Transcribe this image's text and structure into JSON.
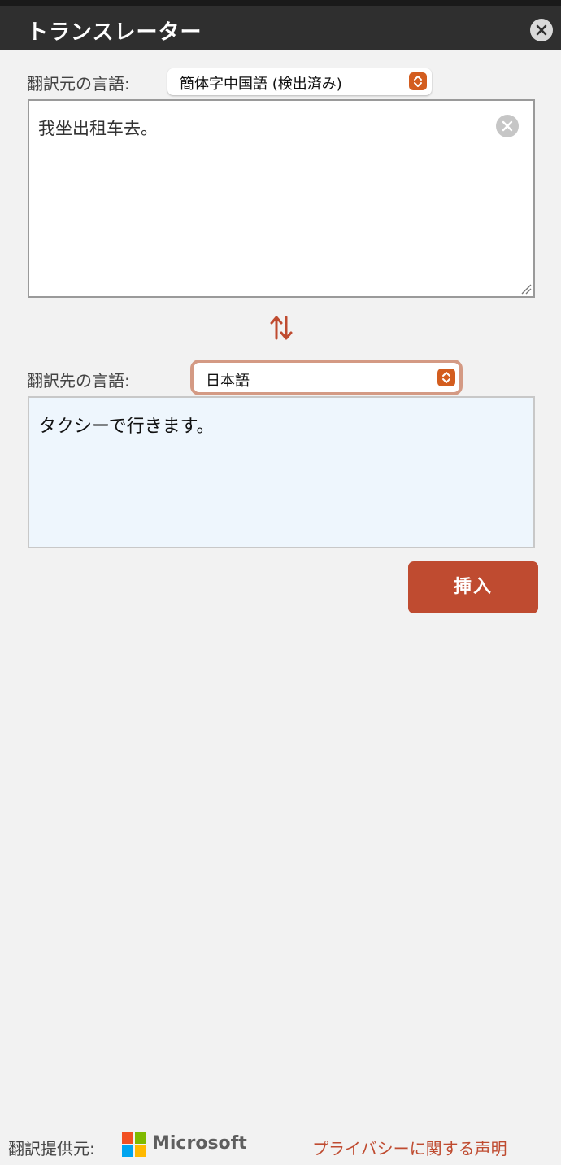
{
  "header": {
    "title": "トランスレーター",
    "close_icon": "close-icon"
  },
  "source": {
    "label": "翻訳元の言語:",
    "selected_language": "簡体字中国語 (検出済み)",
    "text": "我坐出租车去。",
    "clear_icon": "clear-icon"
  },
  "swap_icon": "swap-arrows-icon",
  "target": {
    "label": "翻訳先の言語:",
    "selected_language": "日本語",
    "text": "タクシーで行きます。"
  },
  "insert_button_label": "挿入",
  "footer": {
    "provider_label": "翻訳提供元:",
    "provider_name": "Microsoft",
    "privacy_link": "プライバシーに関する声明"
  },
  "colors": {
    "accent": "#bf4b30",
    "titlebar": "#2f2f2f",
    "select_arrow": "#d35d1f",
    "target_background": "#eef6fd"
  }
}
